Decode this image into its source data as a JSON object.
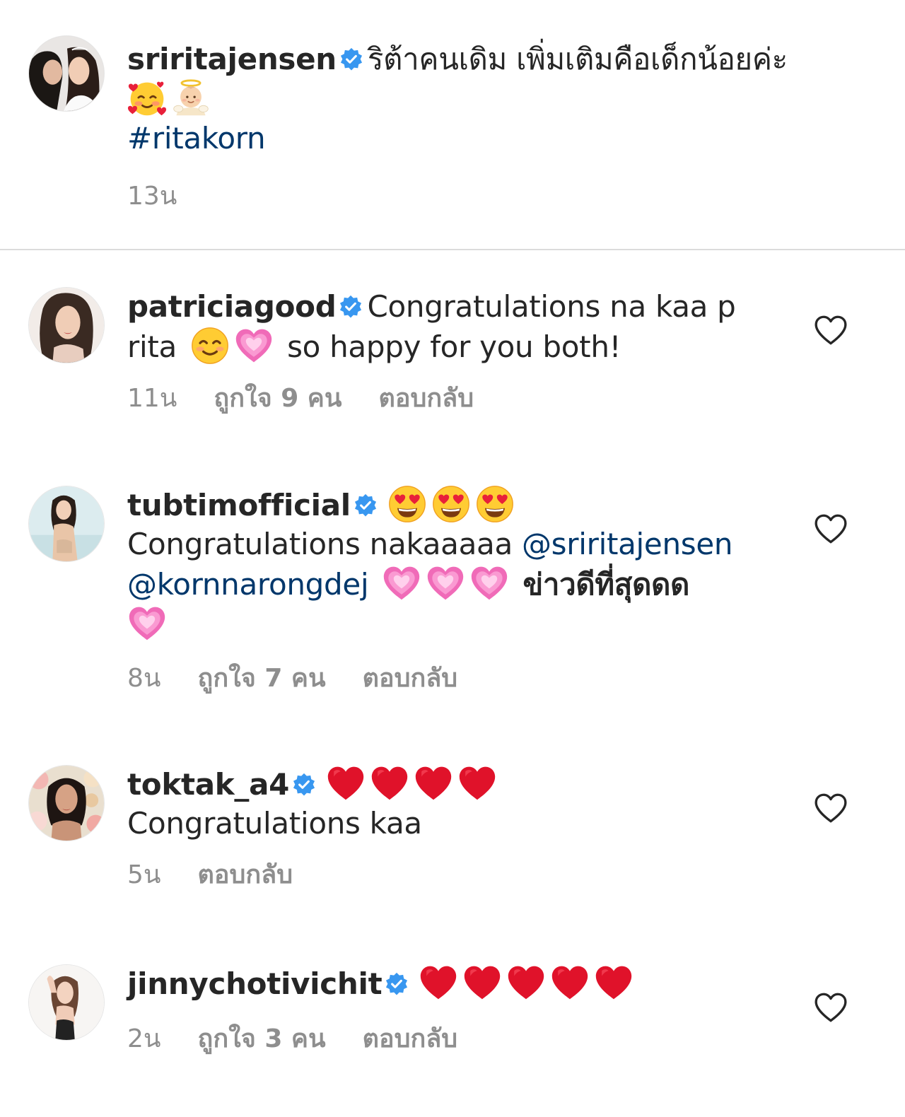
{
  "caption": {
    "username": "sriritajensen",
    "text": "ริต้าคนเดิม เพิ่มเติมคือเด็กน้อยค่ะ",
    "emojis": [
      "smiling-face-with-hearts-emoji",
      "baby-angel-emoji"
    ],
    "hashtag": "#ritakorn",
    "time": "13น"
  },
  "comments": [
    {
      "username": "patriciagood",
      "text_1": "Congratulations na kaa p rita",
      "text_2": "so happy for you both!",
      "emojis": [
        "smiling-face-emoji",
        "growing-heart-emoji"
      ],
      "time": "11น",
      "likes": "ถูกใจ 9 คน",
      "reply": "ตอบกลับ"
    },
    {
      "username": "tubtimofficial",
      "text_1": "Congratulations nakaaaaa",
      "mention_1": "@sriritajensen",
      "mention_2": "@kornnarongdej",
      "text_2": "ข่าวดีที่สุดดด",
      "emojis": [
        "heart-eyes-emoji",
        "growing-heart-emoji"
      ],
      "time": "8น",
      "likes": "ถูกใจ 7 คน",
      "reply": "ตอบกลับ"
    },
    {
      "username": "toktak_a4",
      "text_1": "Congratulations kaa",
      "emojis": [
        "red-heart-emoji"
      ],
      "time": "5น",
      "reply": "ตอบกลับ"
    },
    {
      "username": "jinnychotivichit",
      "emojis": [
        "red-heart-emoji"
      ],
      "time": "2น",
      "likes": "ถูกใจ 3 คน",
      "reply": "ตอบกลับ"
    }
  ],
  "colors": {
    "verified": "#3897f0",
    "link": "#00376b",
    "meta": "#8e8e8e",
    "divider": "#dbdbdb"
  }
}
